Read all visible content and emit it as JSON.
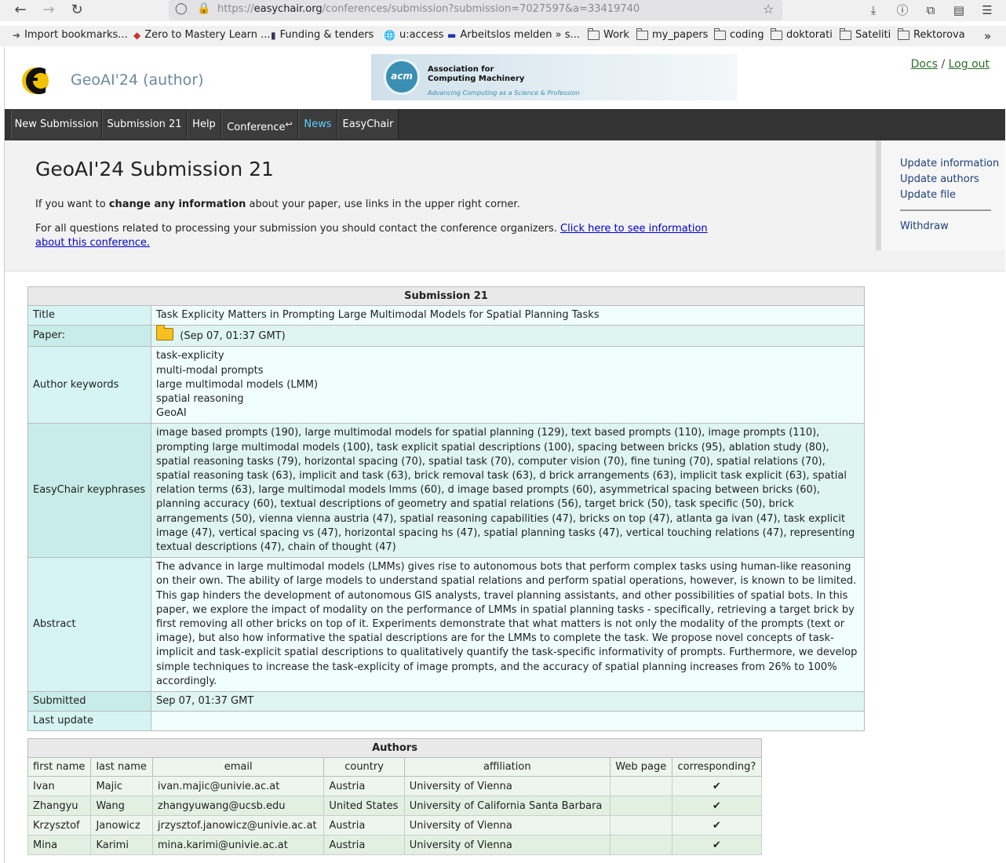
{
  "browser": {
    "url_prefix": "https://",
    "url_domain": "easychair.org",
    "url_path": "/conferences/submission?submission=7027597&a=33419740",
    "bookmarks": [
      "Import bookmarks...",
      "Zero to Mastery Learn ...",
      "Funding & tenders",
      "u:access",
      "Arbeitslos melden » s...",
      "Work",
      "my_papers",
      "coding",
      "doktorati",
      "Sateliti",
      "Rektorova"
    ]
  },
  "header": {
    "conf_title": "GeoAI'24 (author)",
    "acm_logo_text": "acm",
    "acm_name_line1": "Association for",
    "acm_name_line2": "Computing Machinery",
    "acm_tagline": "Advancing Computing as a Science & Profession",
    "docs": "Docs",
    "sep": "/",
    "logout": "Log out"
  },
  "menu": [
    "New Submission",
    "Submission 21",
    "Help",
    "Conference",
    "News",
    "EasyChair"
  ],
  "info": {
    "title": "GeoAI'24 Submission 21",
    "p1_a": "If you want to ",
    "p1_b": "change any information",
    "p1_c": " about your paper, use links in the upper right corner.",
    "p2_a": "For all questions related to processing your submission you should contact the conference organizers. ",
    "p2_link": "Click here to see information about this conference."
  },
  "sidebar": [
    "Update information",
    "Update authors",
    "Update file",
    "Withdraw"
  ],
  "submission": {
    "caption": "Submission 21",
    "labels": {
      "title": "Title",
      "paper": "Paper:",
      "keywords": "Author keywords",
      "keyphrases": "EasyChair keyphrases",
      "abstract": "Abstract",
      "submitted": "Submitted",
      "last_update": "Last update"
    },
    "title": "Task Explicity Matters in Prompting Large Multimodal Models for Spatial Planning Tasks",
    "paper_date": "(Sep 07, 01:37 GMT)",
    "keywords": [
      "task-explicity",
      "multi-modal prompts",
      "large multimodal models (LMM)",
      "spatial reasoning",
      "GeoAI"
    ],
    "keyphrases": "image based prompts (190), large multimodal models for spatial planning (129), text based prompts (110), image prompts (110), prompting large multimodal models (100), task explicit spatial descriptions (100), spacing between bricks (95), ablation study (80), spatial reasoning tasks (79), horizontal spacing (70), spatial task (70), computer vision (70), fine tuning (70), spatial relations (70), spatial reasoning task (63), implicit and task (63), brick removal task (63), d brick arrangements (63), implicit task explicit (63), spatial relation terms (63), large multimodal models lmms (60), d image based prompts (60), asymmetrical spacing between bricks (60), planning accuracy (60), textual descriptions of geometry and spatial relations (56), target brick (50), task specific (50), brick arrangements (50), vienna vienna austria (47), spatial reasoning capabilities (47), bricks on top (47), atlanta ga ivan (47), task explicit image (47), vertical spacing vs (47), horizontal spacing hs (47), spatial planning tasks (47), vertical touching relations (47), representing textual descriptions (47), chain of thought (47)",
    "abstract": "The advance in large multimodal models (LMMs) gives rise to autonomous bots that perform complex tasks using human-like reasoning on their own. The ability of large models to understand spatial relations and perform spatial operations, however, is known to be limited. This gap hinders the development of autonomous GIS analysts, travel planning assistants, and other possibilities of spatial bots. In this paper, we explore the impact of modality on the performance of LMMs in spatial planning tasks - specifically, retrieving a target brick by first removing all other bricks on top of it. Experiments demonstrate that what matters is not only the modality of the prompts (text or image), but also how informative the spatial descriptions are for the LMMs to complete the task. We propose novel concepts of task-implicit and task-explicit spatial descriptions to qualitatively quantify the task-specific informativity of prompts. Furthermore, we develop simple techniques to increase the task-explicity of image prompts, and the accuracy of spatial planning increases from 26% to 100% accordingly.",
    "submitted": "Sep 07, 01:37 GMT",
    "last_update": ""
  },
  "authors": {
    "caption": "Authors",
    "columns": [
      "first name",
      "last name",
      "email",
      "country",
      "affiliation",
      "Web page",
      "corresponding?"
    ],
    "check": "✔",
    "rows": [
      {
        "first": "Ivan",
        "last": "Majic",
        "email": "ivan.majic@univie.ac.at",
        "country": "Austria",
        "affiliation": "University of Vienna",
        "web": ""
      },
      {
        "first": "Zhangyu",
        "last": "Wang",
        "email": "zhangyuwang@ucsb.edu",
        "country": "United States",
        "affiliation": "University of California Santa Barbara",
        "web": ""
      },
      {
        "first": "Krzysztof",
        "last": "Janowicz",
        "email": "jrzysztof.janowicz@univie.ac.at",
        "country": "Austria",
        "affiliation": "University of Vienna",
        "web": ""
      },
      {
        "first": "Mina",
        "last": "Karimi",
        "email": "mina.karimi@univie.ac.at",
        "country": "Austria",
        "affiliation": "University of Vienna",
        "web": ""
      }
    ]
  },
  "colors": {
    "menubar": "#333333",
    "news": "#5fd0ff",
    "link": "#0000cc"
  }
}
